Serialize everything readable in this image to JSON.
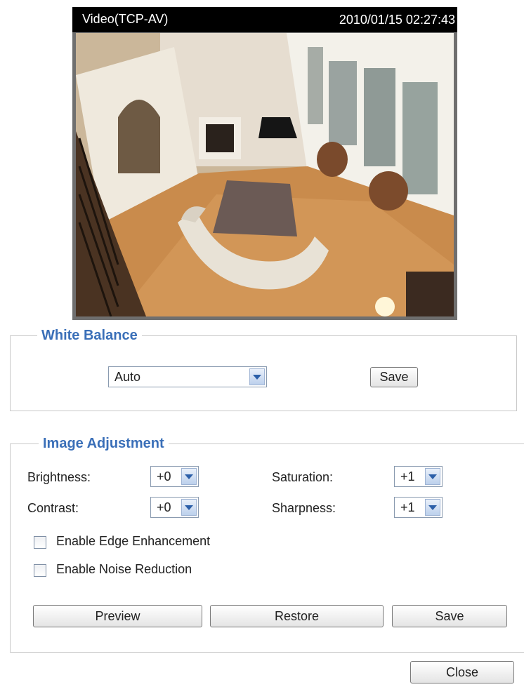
{
  "video": {
    "title": "Video(TCP-AV)",
    "timestamp": "2010/01/15 02:27:43"
  },
  "white_balance": {
    "legend": "White Balance",
    "mode_value": "Auto",
    "save_label": "Save"
  },
  "image_adjustment": {
    "legend": "Image Adjustment",
    "brightness_label": "Brightness:",
    "brightness_value": "+0",
    "contrast_label": "Contrast:",
    "contrast_value": "+0",
    "saturation_label": "Saturation:",
    "saturation_value": "+1",
    "sharpness_label": "Sharpness:",
    "sharpness_value": "+1",
    "edge_label": "Enable Edge Enhancement",
    "edge_checked": false,
    "noise_label": "Enable Noise Reduction",
    "noise_checked": false,
    "preview_label": "Preview",
    "restore_label": "Restore",
    "save_label": "Save"
  },
  "close_label": "Close",
  "colors": {
    "legend": "#3a6fb8",
    "video_border": "#6f6f6f"
  }
}
